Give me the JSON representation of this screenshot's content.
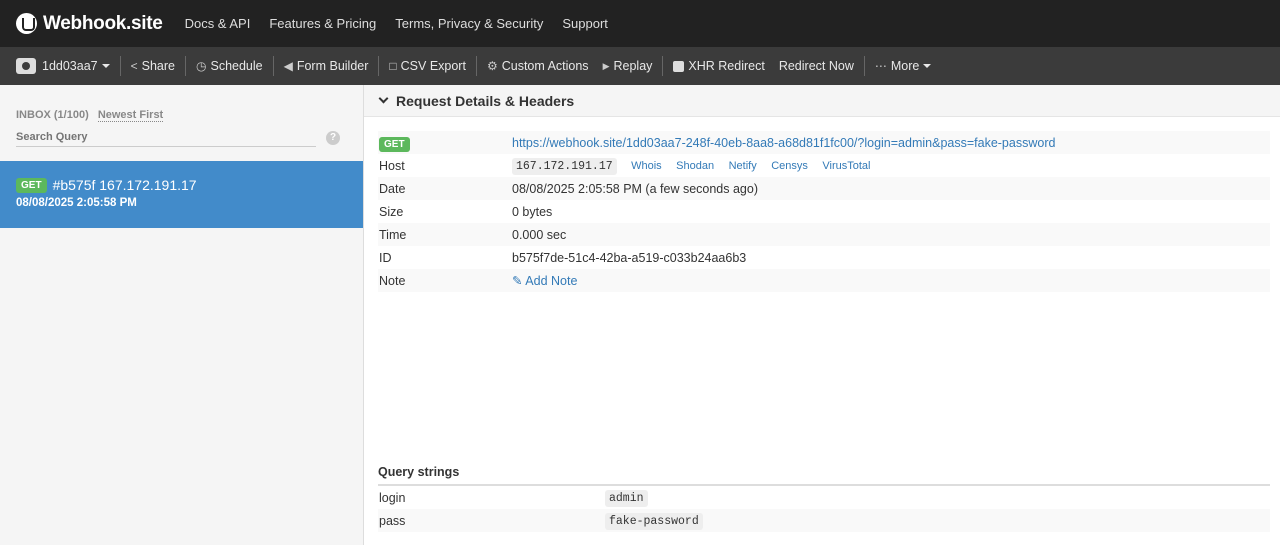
{
  "brand": {
    "name": "Webhook.site"
  },
  "topnav": [
    "Docs & API",
    "Features & Pricing",
    "Terms, Privacy & Security",
    "Support"
  ],
  "toolbar": {
    "token": "1dd03aa7",
    "share": "Share",
    "schedule": "Schedule",
    "form_builder": "Form Builder",
    "csv_export": "CSV Export",
    "custom_actions": "Custom Actions",
    "replay": "Replay",
    "xhr_redirect": "XHR Redirect",
    "redirect_now": "Redirect Now",
    "more": "More"
  },
  "sidebar": {
    "inbox_label": "INBOX (1/100)",
    "sort_label": "Newest First",
    "search_placeholder": "Search Query",
    "help": "?",
    "request": {
      "method": "GET",
      "title": "#b575f 167.172.191.17",
      "time": "08/08/2025 2:05:58 PM"
    }
  },
  "details": {
    "heading": "Request Details & Headers",
    "method": "GET",
    "url": "https://webhook.site/1dd03aa7-248f-40eb-8aa8-a68d81f1fc00/?login=admin&pass=fake-password",
    "host_label": "Host",
    "host": "167.172.191.17",
    "host_links": [
      "Whois",
      "Shodan",
      "Netify",
      "Censys",
      "VirusTotal"
    ],
    "date_label": "Date",
    "date": "08/08/2025 2:05:58 PM (a few seconds ago)",
    "size_label": "Size",
    "size": "0 bytes",
    "time_label": "Time",
    "time": "0.000 sec",
    "id_label": "ID",
    "id": "b575f7de-51c4-42ba-a519-c033b24aa6b3",
    "note_label": "Note",
    "add_note": "Add Note"
  },
  "query_strings": {
    "title": "Query strings",
    "rows": [
      {
        "key": "login",
        "value": "admin"
      },
      {
        "key": "pass",
        "value": "fake-password"
      }
    ]
  }
}
